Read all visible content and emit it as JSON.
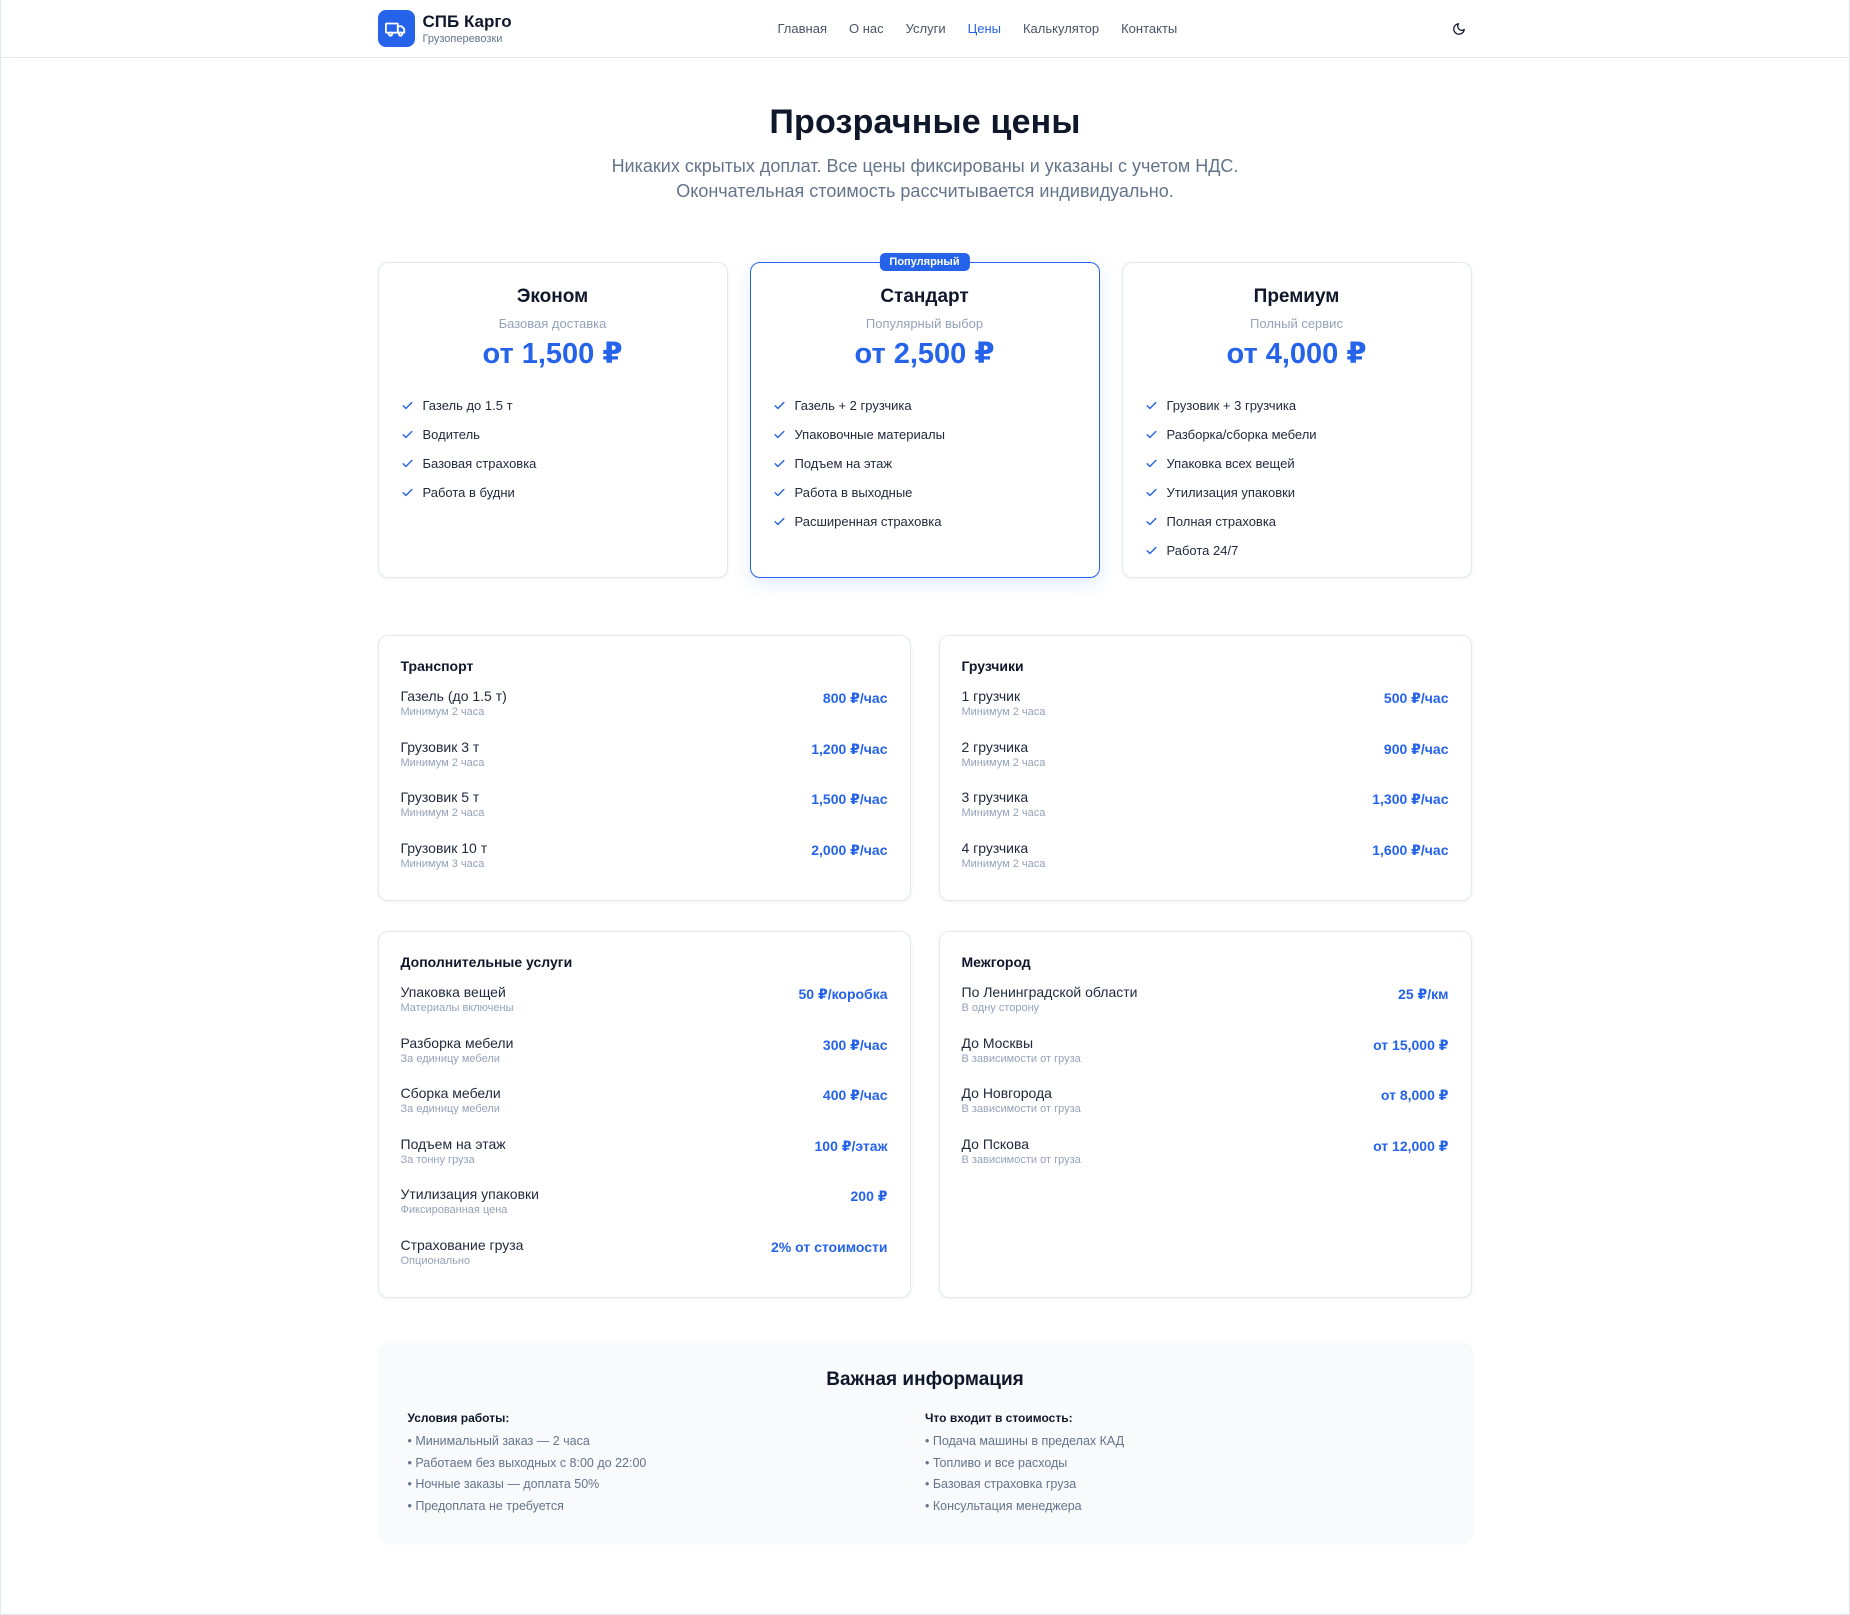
{
  "brand": {
    "name": "СПБ Карго",
    "subtitle": "Грузоперевозки",
    "icon": "truck-icon"
  },
  "nav": {
    "items": [
      "Главная",
      "О нас",
      "Услуги",
      "Цены",
      "Калькулятор",
      "Контакты"
    ],
    "active": "Цены"
  },
  "theme_toggle": {
    "icon": "moon-icon"
  },
  "hero": {
    "title": "Прозрачные цены",
    "line1": "Никаких скрытых доплат. Все цены фиксированы и указаны с учетом НДС.",
    "line2": "Окончательная стоимость рассчитывается индивидуально."
  },
  "plans": [
    {
      "title": "Эконом",
      "subtitle": "Базовая доставка",
      "price": "от 1,500 ₽",
      "features": [
        "Газель до 1.5 т",
        "Водитель",
        "Базовая страховка",
        "Работа в будни"
      ]
    },
    {
      "title": "Стандарт",
      "subtitle": "Популярный выбор",
      "price": "от 2,500 ₽",
      "badge": "Популярный",
      "features": [
        "Газель + 2 грузчика",
        "Упаковочные материалы",
        "Подъем на этаж",
        "Работа в выходные",
        "Расширенная страховка"
      ]
    },
    {
      "title": "Премиум",
      "subtitle": "Полный сервис",
      "price": "от 4,000 ₽",
      "features": [
        "Грузовик + 3 грузчика",
        "Разборка/сборка мебели",
        "Упаковка всех вещей",
        "Утилизация упаковки",
        "Полная страховка",
        "Работа 24/7"
      ]
    }
  ],
  "tables": {
    "transport": {
      "title": "Транспорт",
      "rows": [
        {
          "name": "Газель (до 1.5 т)",
          "note": "Минимум 2 часа",
          "price": "800 ₽/час"
        },
        {
          "name": "Грузовик 3 т",
          "note": "Минимум 2 часа",
          "price": "1,200 ₽/час"
        },
        {
          "name": "Грузовик 5 т",
          "note": "Минимум 2 часа",
          "price": "1,500 ₽/час"
        },
        {
          "name": "Грузовик 10 т",
          "note": "Минимум 3 часа",
          "price": "2,000 ₽/час"
        }
      ]
    },
    "movers": {
      "title": "Грузчики",
      "rows": [
        {
          "name": "1 грузчик",
          "note": "Минимум 2 часа",
          "price": "500 ₽/час"
        },
        {
          "name": "2 грузчика",
          "note": "Минимум 2 часа",
          "price": "900 ₽/час"
        },
        {
          "name": "3 грузчика",
          "note": "Минимум 2 часа",
          "price": "1,300 ₽/час"
        },
        {
          "name": "4 грузчика",
          "note": "Минимум 2 часа",
          "price": "1,600 ₽/час"
        }
      ]
    },
    "extra": {
      "title": "Дополнительные услуги",
      "rows": [
        {
          "name": "Упаковка вещей",
          "note": "Материалы включены",
          "price": "50 ₽/коробка"
        },
        {
          "name": "Разборка мебели",
          "note": "За единицу мебели",
          "price": "300 ₽/час"
        },
        {
          "name": "Сборка мебели",
          "note": "За единицу мебели",
          "price": "400 ₽/час"
        },
        {
          "name": "Подъем на этаж",
          "note": "За тонну груза",
          "price": "100 ₽/этаж"
        },
        {
          "name": "Утилизация упаковки",
          "note": "Фиксированная цена",
          "price": "200 ₽"
        },
        {
          "name": "Страхование груза",
          "note": "Опционально",
          "price": "2% от стоимости"
        }
      ]
    },
    "intercity": {
      "title": "Межгород",
      "rows": [
        {
          "name": "По Ленинградской области",
          "note": "В одну сторону",
          "price": "25 ₽/км"
        },
        {
          "name": "До Москвы",
          "note": "В зависимости от груза",
          "price": "от 15,000 ₽"
        },
        {
          "name": "До Новгорода",
          "note": "В зависимости от груза",
          "price": "от 8,000 ₽"
        },
        {
          "name": "До Пскова",
          "note": "В зависимости от груза",
          "price": "от 12,000 ₽"
        }
      ]
    }
  },
  "info": {
    "title": "Важная информация",
    "left": {
      "title": "Условия работы:",
      "items": [
        "• Минимальный заказ — 2 часа",
        "• Работаем без выходных с 8:00 до 22:00",
        "• Ночные заказы — доплата 50%",
        "• Предоплата не требуется"
      ]
    },
    "right": {
      "title": "Что входит в стоимость:",
      "items": [
        "• Подача машины в пределах КАД",
        "• Топливо и все расходы",
        "• Базовая страховка груза",
        "• Консультация менеджера"
      ]
    }
  },
  "colors": {
    "accent": "#2563eb",
    "text": "#0f172a",
    "muted": "#64748b"
  }
}
